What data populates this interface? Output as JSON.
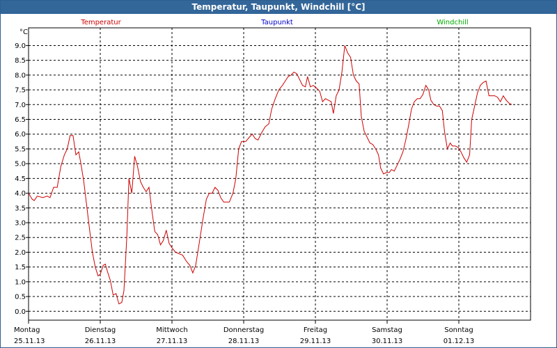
{
  "window": {
    "title": "Temperatur, Taupunkt, Windchill [°C]"
  },
  "chart_data": {
    "type": "line",
    "title": "Temperatur, Taupunkt, Windchill [°C]",
    "yunit": "°C",
    "ylim": [
      -0.3,
      9.6
    ],
    "yticks": [
      "0.0",
      "0.5",
      "1.0",
      "1.5",
      "2.0",
      "2.5",
      "3.0",
      "3.5",
      "4.0",
      "4.5",
      "5.0",
      "5.5",
      "6.0",
      "6.5",
      "7.0",
      "7.5",
      "8.0",
      "8.5",
      "9.0"
    ],
    "grid": true,
    "legend_position": "top",
    "xlim": [
      0,
      6.97
    ],
    "x_ticks": [
      {
        "day": "Montag",
        "date": "25.11.13"
      },
      {
        "day": "Dienstag",
        "date": "26.11.13"
      },
      {
        "day": "Mittwoch",
        "date": "27.11.13"
      },
      {
        "day": "Donnerstag",
        "date": "28.11.13"
      },
      {
        "day": "Freitag",
        "date": "29.11.13"
      },
      {
        "day": "Samstag",
        "date": "30.11.13"
      },
      {
        "day": "Sonntag",
        "date": "01.12.13"
      }
    ],
    "series": [
      {
        "name": "Temperatur",
        "color": "#cc0000",
        "points": [
          [
            0.0,
            4.0
          ],
          [
            0.05,
            3.8
          ],
          [
            0.08,
            3.75
          ],
          [
            0.12,
            3.9
          ],
          [
            0.2,
            3.85
          ],
          [
            0.26,
            3.9
          ],
          [
            0.3,
            3.85
          ],
          [
            0.35,
            4.2
          ],
          [
            0.4,
            4.2
          ],
          [
            0.45,
            4.9
          ],
          [
            0.5,
            5.3
          ],
          [
            0.54,
            5.5
          ],
          [
            0.58,
            5.95
          ],
          [
            0.62,
            5.95
          ],
          [
            0.66,
            5.3
          ],
          [
            0.7,
            5.4
          ],
          [
            0.73,
            5.0
          ],
          [
            0.77,
            4.4
          ],
          [
            0.81,
            3.6
          ],
          [
            0.85,
            2.8
          ],
          [
            0.89,
            2.0
          ],
          [
            0.93,
            1.5
          ],
          [
            0.97,
            1.2
          ],
          [
            1.0,
            1.25
          ],
          [
            1.04,
            1.55
          ],
          [
            1.07,
            1.6
          ],
          [
            1.1,
            1.35
          ],
          [
            1.14,
            1.05
          ],
          [
            1.18,
            0.55
          ],
          [
            1.22,
            0.6
          ],
          [
            1.26,
            0.25
          ],
          [
            1.3,
            0.3
          ],
          [
            1.33,
            0.7
          ],
          [
            1.37,
            2.5
          ],
          [
            1.4,
            4.5
          ],
          [
            1.44,
            4.0
          ],
          [
            1.48,
            5.25
          ],
          [
            1.52,
            4.9
          ],
          [
            1.56,
            4.4
          ],
          [
            1.6,
            4.2
          ],
          [
            1.64,
            4.05
          ],
          [
            1.68,
            4.2
          ],
          [
            1.72,
            3.4
          ],
          [
            1.76,
            2.7
          ],
          [
            1.8,
            2.6
          ],
          [
            1.84,
            2.25
          ],
          [
            1.88,
            2.4
          ],
          [
            1.92,
            2.75
          ],
          [
            1.96,
            2.3
          ],
          [
            2.0,
            2.15
          ],
          [
            2.05,
            2.0
          ],
          [
            2.1,
            1.95
          ],
          [
            2.15,
            1.9
          ],
          [
            2.2,
            1.7
          ],
          [
            2.25,
            1.55
          ],
          [
            2.29,
            1.3
          ],
          [
            2.33,
            1.55
          ],
          [
            2.38,
            2.3
          ],
          [
            2.43,
            3.1
          ],
          [
            2.48,
            3.8
          ],
          [
            2.52,
            4.0
          ],
          [
            2.56,
            4.0
          ],
          [
            2.6,
            4.2
          ],
          [
            2.64,
            4.1
          ],
          [
            2.68,
            3.85
          ],
          [
            2.72,
            3.7
          ],
          [
            2.8,
            3.7
          ],
          [
            2.85,
            4.0
          ],
          [
            2.89,
            4.5
          ],
          [
            2.93,
            5.5
          ],
          [
            2.97,
            5.75
          ],
          [
            3.03,
            5.75
          ],
          [
            3.08,
            5.9
          ],
          [
            3.12,
            6.0
          ],
          [
            3.16,
            5.85
          ],
          [
            3.2,
            5.8
          ],
          [
            3.25,
            6.05
          ],
          [
            3.3,
            6.25
          ],
          [
            3.35,
            6.35
          ],
          [
            3.39,
            6.85
          ],
          [
            3.44,
            7.2
          ],
          [
            3.49,
            7.5
          ],
          [
            3.54,
            7.65
          ],
          [
            3.58,
            7.8
          ],
          [
            3.62,
            7.95
          ],
          [
            3.66,
            8.0
          ],
          [
            3.7,
            8.1
          ],
          [
            3.74,
            8.05
          ],
          [
            3.78,
            7.85
          ],
          [
            3.82,
            7.65
          ],
          [
            3.86,
            7.6
          ],
          [
            3.89,
            7.95
          ],
          [
            3.93,
            7.6
          ],
          [
            3.97,
            7.65
          ],
          [
            4.02,
            7.55
          ],
          [
            4.06,
            7.45
          ],
          [
            4.1,
            7.1
          ],
          [
            4.14,
            7.2
          ],
          [
            4.18,
            7.15
          ],
          [
            4.22,
            7.1
          ],
          [
            4.25,
            6.7
          ],
          [
            4.29,
            7.3
          ],
          [
            4.33,
            7.5
          ],
          [
            4.37,
            8.1
          ],
          [
            4.41,
            9.0
          ],
          [
            4.45,
            8.75
          ],
          [
            4.49,
            8.6
          ],
          [
            4.53,
            8.0
          ],
          [
            4.57,
            7.8
          ],
          [
            4.61,
            7.7
          ],
          [
            4.64,
            6.6
          ],
          [
            4.68,
            6.1
          ],
          [
            4.72,
            5.9
          ],
          [
            4.76,
            5.7
          ],
          [
            4.8,
            5.65
          ],
          [
            4.84,
            5.5
          ],
          [
            4.88,
            5.3
          ],
          [
            4.91,
            4.85
          ],
          [
            4.95,
            4.65
          ],
          [
            4.99,
            4.7
          ],
          [
            5.03,
            4.7
          ],
          [
            5.06,
            4.8
          ],
          [
            5.1,
            4.75
          ],
          [
            5.14,
            4.95
          ],
          [
            5.18,
            5.15
          ],
          [
            5.22,
            5.4
          ],
          [
            5.26,
            5.8
          ],
          [
            5.3,
            6.3
          ],
          [
            5.34,
            6.85
          ],
          [
            5.38,
            7.1
          ],
          [
            5.42,
            7.2
          ],
          [
            5.46,
            7.2
          ],
          [
            5.5,
            7.35
          ],
          [
            5.54,
            7.65
          ],
          [
            5.58,
            7.5
          ],
          [
            5.61,
            7.15
          ],
          [
            5.65,
            7.0
          ],
          [
            5.69,
            6.95
          ],
          [
            5.73,
            6.95
          ],
          [
            5.77,
            6.8
          ],
          [
            5.8,
            6.1
          ],
          [
            5.84,
            5.5
          ],
          [
            5.88,
            5.7
          ],
          [
            5.91,
            5.6
          ],
          [
            5.95,
            5.6
          ],
          [
            5.99,
            5.55
          ],
          [
            6.03,
            5.4
          ],
          [
            6.07,
            5.2
          ],
          [
            6.11,
            5.05
          ],
          [
            6.15,
            5.3
          ],
          [
            6.18,
            6.5
          ],
          [
            6.22,
            6.95
          ],
          [
            6.26,
            7.4
          ],
          [
            6.3,
            7.65
          ],
          [
            6.34,
            7.75
          ],
          [
            6.38,
            7.8
          ],
          [
            6.42,
            7.3
          ],
          [
            6.46,
            7.3
          ],
          [
            6.5,
            7.3
          ],
          [
            6.54,
            7.25
          ],
          [
            6.58,
            7.1
          ],
          [
            6.62,
            7.3
          ],
          [
            6.66,
            7.15
          ],
          [
            6.7,
            7.05
          ],
          [
            6.74,
            7.0
          ]
        ]
      },
      {
        "name": "Taupunkt",
        "color": "#0000cc",
        "points": []
      },
      {
        "name": "Windchill",
        "color": "#00aa00",
        "points": []
      }
    ]
  }
}
